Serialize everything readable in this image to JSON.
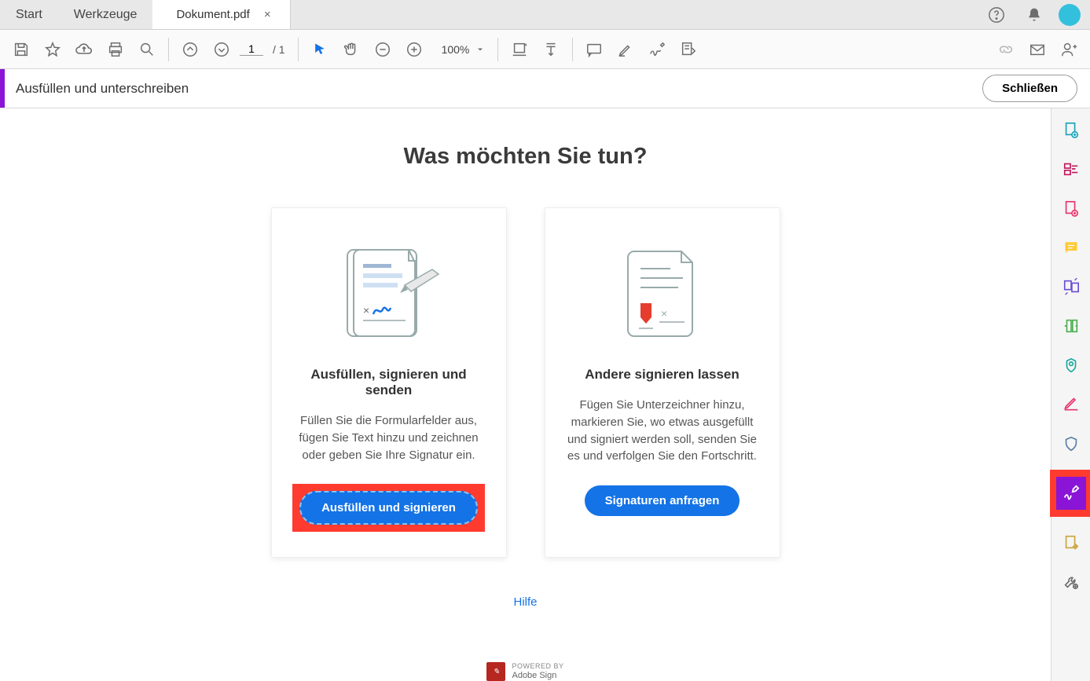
{
  "tabs": {
    "start": "Start",
    "tools": "Werkzeuge",
    "doc": "Dokument.pdf",
    "close_x": "×"
  },
  "toolbar": {
    "page_current": "1",
    "page_total": "/ 1",
    "zoom": "100%"
  },
  "tool_header": {
    "title": "Ausfüllen und unterschreiben",
    "close": "Schließen"
  },
  "main": {
    "headline": "Was möchten Sie tun?",
    "card_left": {
      "title": "Ausfüllen, signieren und senden",
      "desc": "Füllen Sie die Formularfelder aus, fügen Sie Text hinzu und zeichnen oder geben Sie Ihre Signatur ein.",
      "button": "Ausfüllen und signieren"
    },
    "card_right": {
      "title": "Andere signieren lassen",
      "desc": "Fügen Sie Unterzeichner hinzu, markieren Sie, wo etwas ausgefüllt und signiert werden soll, senden Sie es und verfolgen Sie den Fortschritt.",
      "button": "Signaturen anfragen"
    },
    "help": "Hilfe"
  },
  "footer": {
    "powered": "POWERED BY",
    "brand": "Adobe Sign"
  }
}
